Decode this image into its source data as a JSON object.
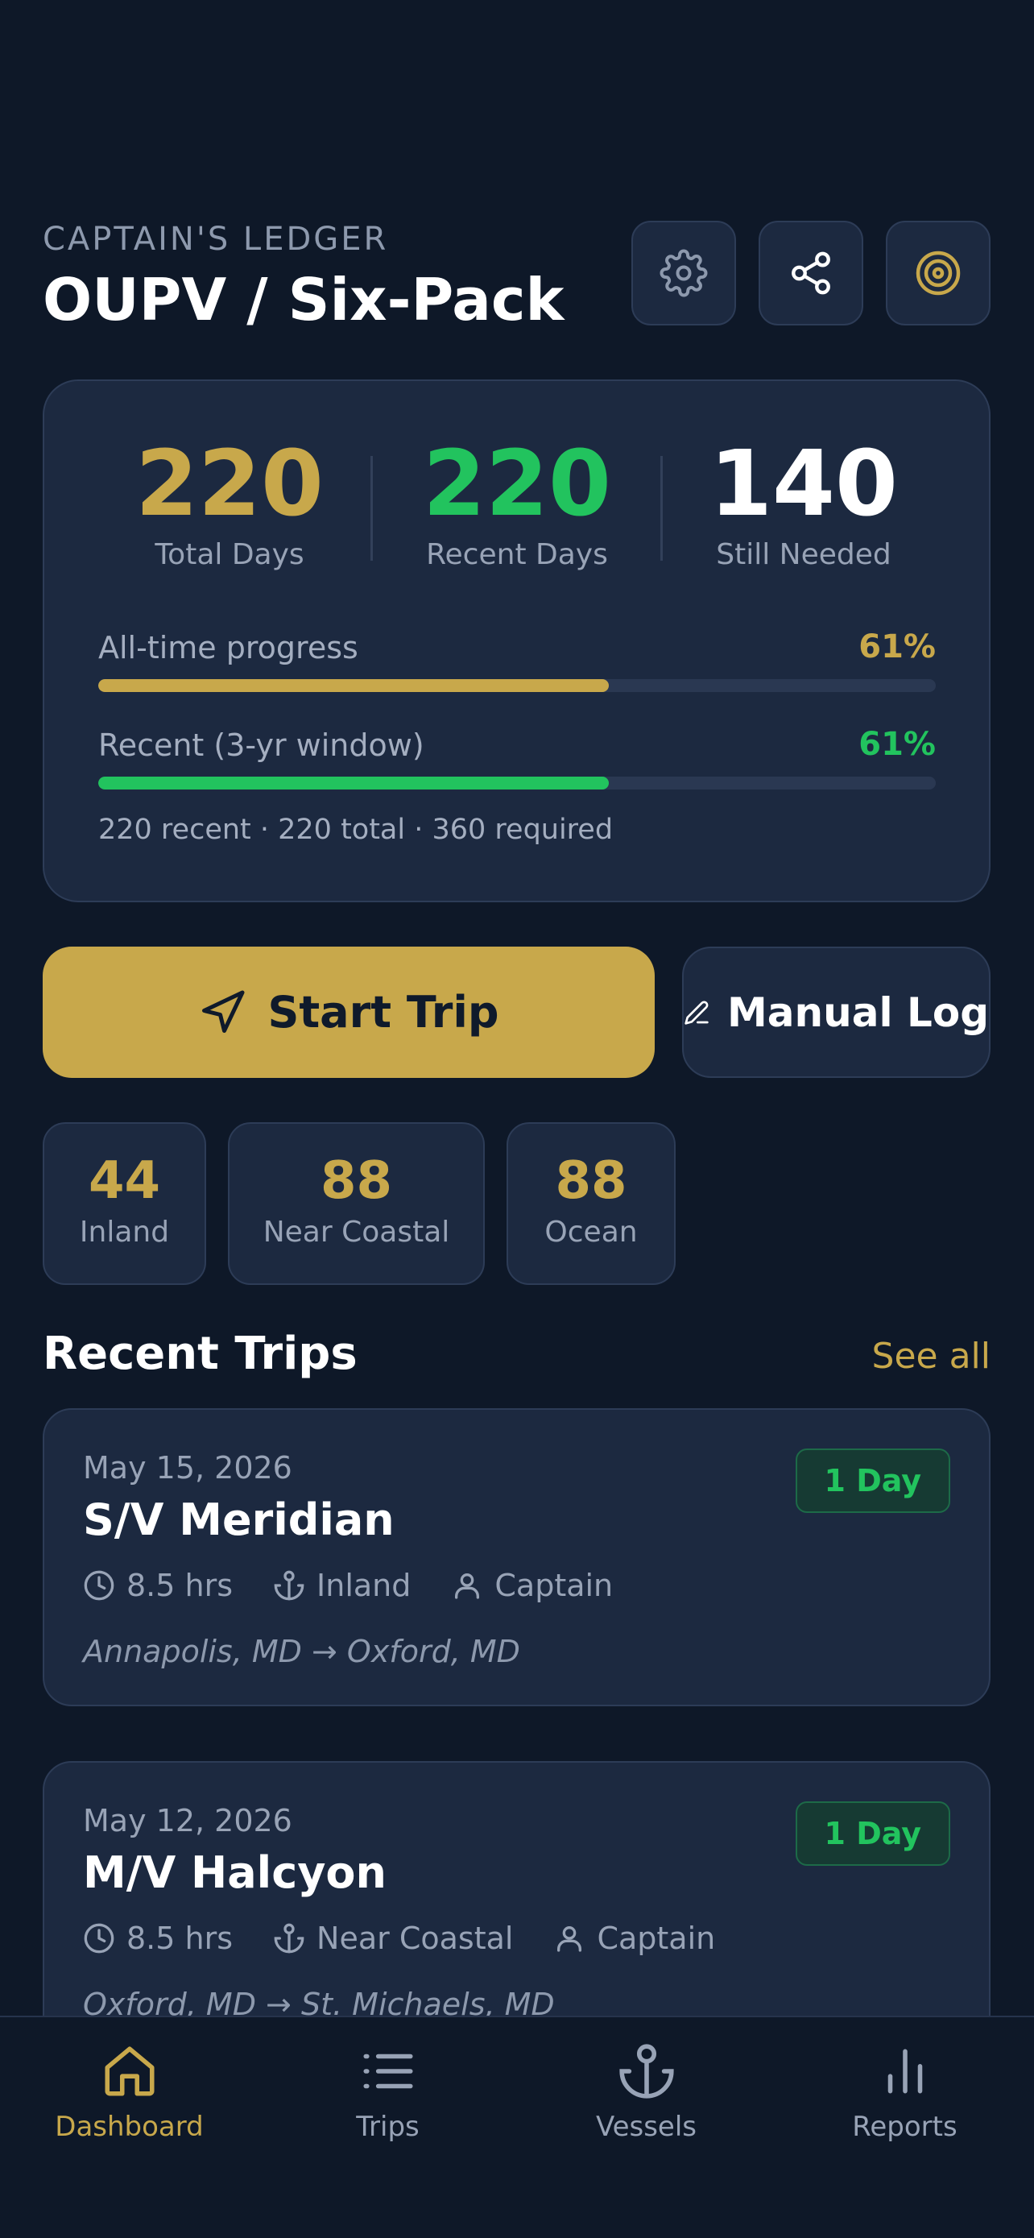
{
  "header": {
    "eyebrow": "CAPTAIN'S LEDGER",
    "title": "OUPV / Six-Pack",
    "icons": [
      "gear-icon",
      "share-icon",
      "target-icon"
    ]
  },
  "stats": {
    "total_days": "220",
    "total_days_label": "Total Days",
    "recent_days": "220",
    "recent_days_label": "Recent Days",
    "still_needed": "140",
    "still_needed_label": "Still Needed",
    "alltime_label": "All-time progress",
    "alltime_pct": "61%",
    "alltime_progress": 0.61,
    "recent_label": "Recent (3-yr window)",
    "recent_pct": "61%",
    "recent_progress": 0.61,
    "summary": "220 recent · 220 total · 360 required"
  },
  "actions": {
    "start_trip": "Start Trip",
    "manual_log": "Manual Log"
  },
  "regions": [
    {
      "value": "44",
      "label": "Inland"
    },
    {
      "value": "88",
      "label": "Near Coastal"
    },
    {
      "value": "88",
      "label": "Ocean"
    }
  ],
  "recent_trips": {
    "title": "Recent Trips",
    "see_all": "See all",
    "items": [
      {
        "date": "May 15, 2026",
        "vessel": "S/V Meridian",
        "badge": "1 Day",
        "hours": "8.5 hrs",
        "waters": "Inland",
        "role": "Captain",
        "route": "Annapolis, MD → Oxford, MD"
      },
      {
        "date": "May 12, 2026",
        "vessel": "M/V Halcyon",
        "badge": "1 Day",
        "hours": "8.5 hrs",
        "waters": "Near Coastal",
        "role": "Captain",
        "route": "Oxford, MD → St. Michaels, MD"
      }
    ]
  },
  "nav": [
    {
      "label": "Dashboard",
      "icon": "home-icon",
      "active": true
    },
    {
      "label": "Trips",
      "icon": "list-icon",
      "active": false
    },
    {
      "label": "Vessels",
      "icon": "anchor-icon",
      "active": false
    },
    {
      "label": "Reports",
      "icon": "bar-chart-icon",
      "active": false
    }
  ],
  "colors": {
    "background": "#0e1828",
    "card": "#1c2940",
    "gold": "#c8a84b",
    "green": "#22c35e",
    "muted": "#98a3b6"
  }
}
